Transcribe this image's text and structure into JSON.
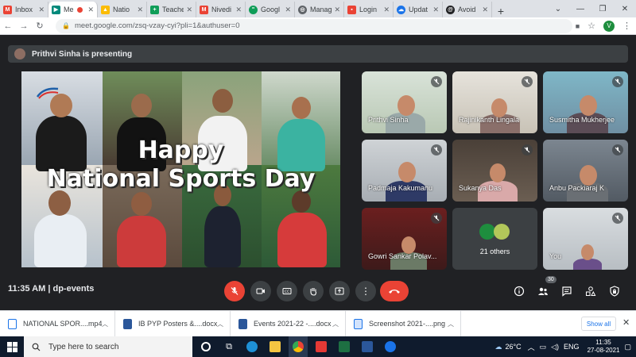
{
  "browser": {
    "tabs": [
      {
        "label": "Inbox",
        "icon": "gmail-icon",
        "color": "#ea4335",
        "active": false
      },
      {
        "label": "Me",
        "icon": "meet-icon",
        "color": "#00897b",
        "active": true
      },
      {
        "label": "Natio",
        "icon": "google-drive-icon",
        "color": "#fbbc04",
        "active": false
      },
      {
        "label": "Teache",
        "icon": "google-classroom-icon",
        "color": "#0f9d58",
        "active": false
      },
      {
        "label": "Nivedi",
        "icon": "gmail-icon",
        "color": "#ea4335",
        "active": false
      },
      {
        "label": "Googl",
        "icon": "hangouts-icon",
        "color": "#0f9d58",
        "active": false
      },
      {
        "label": "Manag",
        "icon": "globe-icon",
        "color": "#5f6368",
        "active": false
      },
      {
        "label": "Login",
        "icon": "lock-icon",
        "color": "#ea4335",
        "active": false
      },
      {
        "label": "Updat",
        "icon": "cloud-icon",
        "color": "#1a73e8",
        "active": false
      },
      {
        "label": "Avoid",
        "icon": "threads-icon",
        "color": "#202124",
        "active": false
      }
    ],
    "new_tab": "+",
    "url": "meet.google.com/zsq-vzay-cyi?pli=1&authuser=0",
    "profile_initial": "V"
  },
  "meet": {
    "presenting_text": "Prithvi Sinha is presenting",
    "share": {
      "title_line1": "Happy",
      "title_line2": "National Sports Day"
    },
    "tiles": [
      {
        "name": "Prithvi Sinha",
        "muted": true
      },
      {
        "name": "Rajinikanth Lingala",
        "muted": true
      },
      {
        "name": "Susmitha Mukherjee",
        "muted": true
      },
      {
        "name": "Padmaja Kakumanu",
        "muted": true
      },
      {
        "name": "Sukanya Das",
        "muted": true
      },
      {
        "name": "Anbu Packiaraj K",
        "muted": true
      },
      {
        "name": "Gowri Sankar Polav...",
        "muted": true
      },
      {
        "name": "21 others",
        "muted": false
      },
      {
        "name": "You",
        "muted": true
      }
    ],
    "controls": {
      "time_meeting": "11:35 AM  |  dp-events",
      "participant_count": "30"
    }
  },
  "downloads": {
    "items": [
      {
        "name": "NATIONAL SPOR....mp4"
      },
      {
        "name": "IB PYP Posters &....docx"
      },
      {
        "name": "Events 2021-22 -....docx"
      },
      {
        "name": "Screenshot 2021-....png"
      }
    ],
    "show_all": "Show all",
    "close": "✕"
  },
  "taskbar": {
    "search_placeholder": "Type here to search",
    "temperature": "26°C",
    "language": "ENG",
    "time": "11:35",
    "date": "27-08-2021"
  },
  "colors": {
    "meet_bg": "#202124",
    "end_call": "#ea4335",
    "accent": "#1a73e8"
  }
}
